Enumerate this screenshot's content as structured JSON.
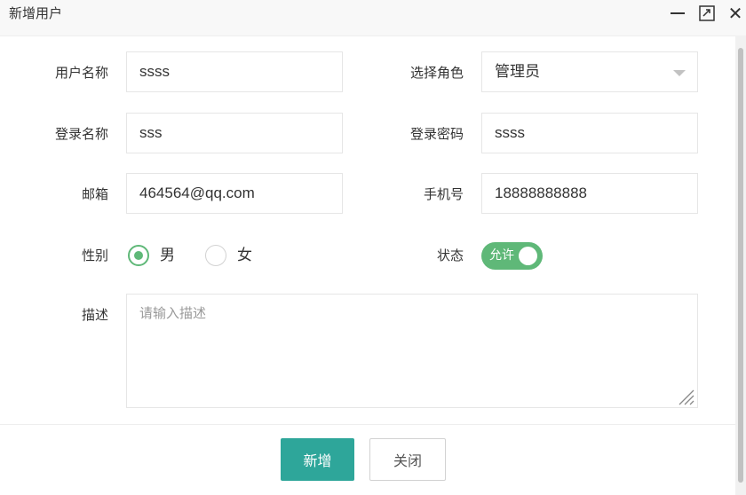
{
  "dialog": {
    "title": "新增用户",
    "controls": {
      "minimize_icon": "minimize-icon",
      "maximize_icon": "maximize-icon",
      "close_icon": "close-icon"
    }
  },
  "form": {
    "username": {
      "label": "用户名称",
      "value": "ssss"
    },
    "role": {
      "label": "选择角色",
      "value": "管理员"
    },
    "login_name": {
      "label": "登录名称",
      "value": "sss"
    },
    "password": {
      "label": "登录密码",
      "value": "ssss"
    },
    "email": {
      "label": "邮箱",
      "value": "464564@qq.com"
    },
    "phone": {
      "label": "手机号",
      "value": "18888888888"
    },
    "gender": {
      "label": "性别",
      "options": [
        "男",
        "女"
      ],
      "selected": "男"
    },
    "status": {
      "label": "状态",
      "switch_text": "允许",
      "on": true
    },
    "description": {
      "label": "描述",
      "placeholder": "请输入描述",
      "value": ""
    }
  },
  "footer": {
    "submit_label": "新增",
    "close_label": "关闭"
  },
  "colors": {
    "accent": "#2ea69a",
    "switch_on": "#5fb878"
  }
}
